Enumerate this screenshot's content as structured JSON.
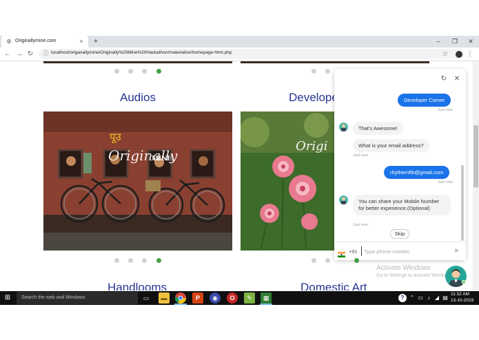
{
  "browser": {
    "tab_title": "Originallymine.com",
    "url": "localhost/origanallymine/Originally%20Mine%20Hackathon/materialize/homepage-html.php",
    "tab_close": "×",
    "new_tab": "+",
    "window_controls": {
      "minimize": "–",
      "restore": "❐",
      "close": "✕"
    },
    "nav": {
      "back": "←",
      "forward": "→",
      "reload": "↻"
    }
  },
  "page": {
    "sections": [
      {
        "title": "Audios",
        "watermark_top": "पूउ",
        "watermark": "Originally",
        "watermark_tail": "MINE"
      },
      {
        "title": "Develope",
        "watermark": "Origi"
      },
      {
        "title": "Handlooms"
      },
      {
        "title": "Domestic Art"
      }
    ],
    "carousel_active_index": 3
  },
  "chat": {
    "messages": [
      {
        "from": "user",
        "text": "Developer Corner",
        "time": "Just now"
      },
      {
        "from": "bot",
        "text": "That's Awesome!"
      },
      {
        "from": "bot",
        "text": "What is your email address?",
        "time": "Just now"
      },
      {
        "from": "user",
        "text": "rhythemftb@gmail.com",
        "time": "Just now"
      },
      {
        "from": "bot",
        "text": "You can share your Mobile Number for better experience.(Optional)",
        "time": "Just now"
      }
    ],
    "skip_label": "Skip",
    "country_code": "+91",
    "phone_placeholder": "Type phone number"
  },
  "activate_windows": {
    "title": "Activate Windows",
    "subtitle": "Go to Settings to activate Windows."
  },
  "taskbar": {
    "search_placeholder": "Search the web and Windows",
    "time": "11:32 AM",
    "date": "13-10-2019"
  },
  "colors": {
    "accent_blue": "#1a73e8",
    "title_blue": "#283593",
    "carousel_active": "#43a047",
    "taskbar": "#101010"
  }
}
